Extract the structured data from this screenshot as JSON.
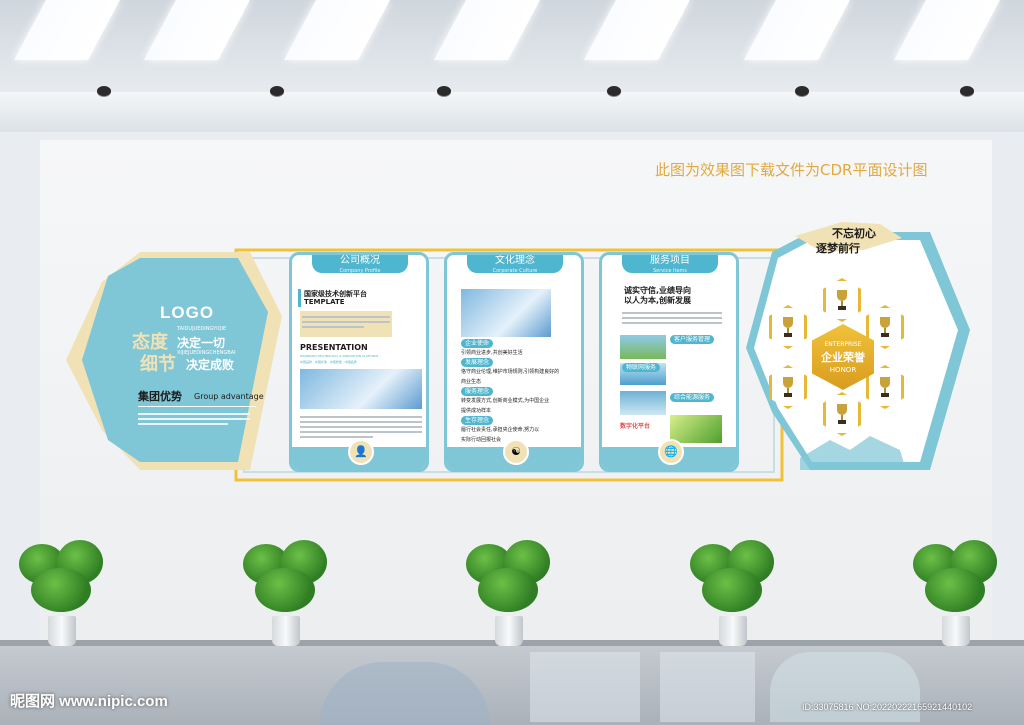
{
  "top_note": "此图为效果图下载文件为CDR平面设计图",
  "left_hex": {
    "logo": "LOGO",
    "pinyin_1": "TAIDUJUEDINGYIQIE",
    "attitude": "态度",
    "decide_all": "决定一切",
    "detail": "细节",
    "decide_success": "决定成败",
    "pinyin_2": "XIJIEJUEDINGCHENGBAI",
    "advantage_cn": "集团优势",
    "advantage_en": "Group advantage"
  },
  "panel_1": {
    "tab_title": "公司概况",
    "tab_sub": "Company Profile",
    "heading": "国家级技术创新平台",
    "template": "TEMPLATE",
    "presentation": "PRESENTATION",
    "pres_sub": "IPO/BRAND TECHNOLOGY & INNOVATION PLATFORM",
    "tags": "中国品牌 · 中国标准 · 中国质量 · 中国品质"
  },
  "panel_2": {
    "tab_title": "文化理念",
    "tab_sub": "Corporate Culture",
    "pill_1": "企业使命",
    "text_1": "引领商业进步,共创美好生活",
    "pill_2": "发展理念",
    "text_2a": "恪守商业伦理,维护市场规则,引领构建良好的",
    "text_2b": "商业生态",
    "pill_3": "服务理念",
    "text_3a": "转变发展方式,创新商业模式,为中国企业",
    "text_3b": "提供成功样本",
    "pill_4": "生存理念",
    "text_4a": "履行社会责任,承担央企使命,努力以",
    "text_4b": "实际行动回报社会"
  },
  "panel_3": {
    "tab_title": "服务项目",
    "tab_sub": "Service Items",
    "slogan_1": "诚实守信,业绩导向",
    "slogan_2": "以人为本,创新发展",
    "item_1": "客户服务管理",
    "item_2": "物联网服务",
    "item_3": "综合能源服务",
    "item_4": "数字化平台"
  },
  "right_hex": {
    "motto_1": "不忘初心",
    "motto_2": "逐梦前行",
    "honor_en_1": "ENTERPRISE",
    "honor_cn": "企业荣誉",
    "honor_en_2": "HONOR"
  },
  "watermark": {
    "site": "昵图网 www.nipic.com",
    "id": "ID:33075816 NO:20220222165921440102"
  },
  "colors": {
    "accent_blue": "#7fc6d6",
    "tab_blue": "#4fb6d0",
    "gold": "#e6b835",
    "cream": "#f1e2b6",
    "note_orange": "#e2a93c"
  }
}
